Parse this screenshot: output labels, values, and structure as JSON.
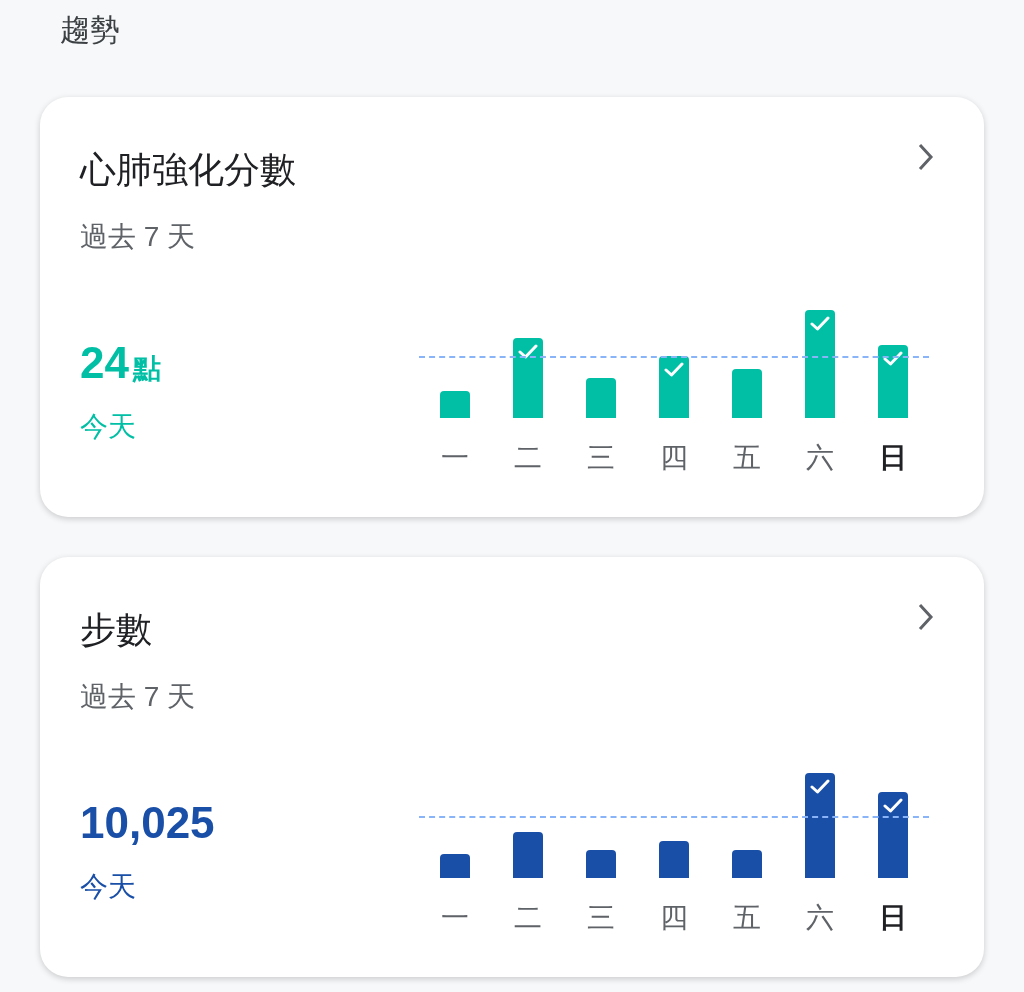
{
  "section_title": "趨勢",
  "cards": [
    {
      "color": "#00bfa5",
      "title": "心肺強化分數",
      "subtitle": "過去 7 天",
      "value": "24",
      "unit": "點",
      "value_caption": "今天",
      "days": [
        {
          "label": "一",
          "goal_met": false,
          "selected": false
        },
        {
          "label": "二",
          "goal_met": true,
          "selected": false
        },
        {
          "label": "三",
          "goal_met": false,
          "selected": false
        },
        {
          "label": "四",
          "goal_met": true,
          "selected": false
        },
        {
          "label": "五",
          "goal_met": false,
          "selected": false
        },
        {
          "label": "六",
          "goal_met": true,
          "selected": false
        },
        {
          "label": "日",
          "goal_met": true,
          "selected": true
        }
      ]
    },
    {
      "color": "#1a4fa8",
      "title": "步數",
      "subtitle": "過去 7 天",
      "value": "10,025",
      "value_caption": "今天",
      "days": [
        {
          "label": "一",
          "goal_met": false,
          "selected": false
        },
        {
          "label": "二",
          "goal_met": false,
          "selected": false
        },
        {
          "label": "三",
          "goal_met": false,
          "selected": false
        },
        {
          "label": "四",
          "goal_met": false,
          "selected": false
        },
        {
          "label": "五",
          "goal_met": false,
          "selected": false
        },
        {
          "label": "六",
          "goal_met": true,
          "selected": false
        },
        {
          "label": "日",
          "goal_met": true,
          "selected": true
        }
      ]
    }
  ]
}
